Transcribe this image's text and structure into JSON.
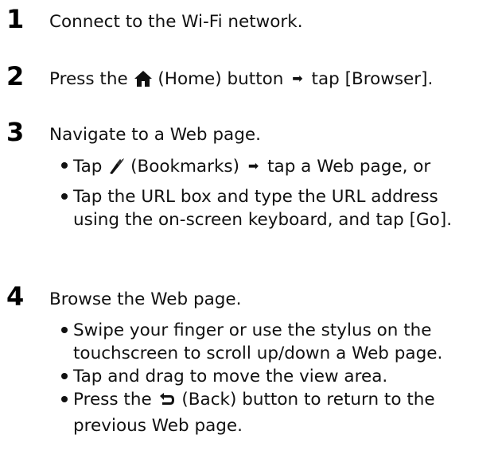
{
  "steps": [
    {
      "number": "1",
      "text": "Connect to the Wi-Fi network."
    },
    {
      "number": "2",
      "text_before": "Press the",
      "icon": "home-icon",
      "text_icon_label": "(Home) button",
      "arrow": "➡",
      "text_after": "tap [Browser]."
    },
    {
      "number": "3",
      "text": "Navigate to a Web page.",
      "bullets": [
        {
          "text_before": "Tap",
          "icon": "bookmarks-icon",
          "text_icon_label": "(Bookmarks)",
          "arrow": "➡",
          "text_after": "tap a Web page, or"
        },
        {
          "line1": "Tap the URL box and type the URL address",
          "line2": "using the on-screen keyboard, and tap [Go]."
        }
      ]
    },
    {
      "number": "4",
      "text": "Browse the Web page.",
      "bullets": [
        {
          "line1": "Swipe your finger or use the stylus on the",
          "line2": "touchscreen to scroll up/down a Web page."
        },
        {
          "line1": "Tap and drag to move the view area."
        },
        {
          "text_before": "Press the",
          "icon": "back-icon",
          "text_after": "(Back) button to return to the",
          "line2": "previous Web page."
        }
      ]
    }
  ]
}
